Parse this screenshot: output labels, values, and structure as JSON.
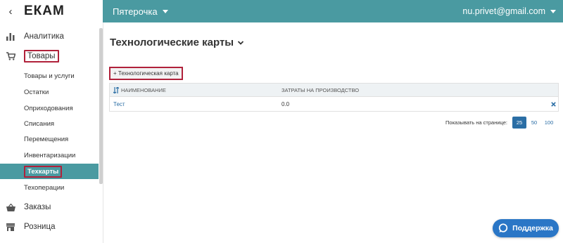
{
  "sidebar": {
    "back_glyph": "‹",
    "logo": "ЕКАМ",
    "items": [
      {
        "label": "Аналитика",
        "icon": "bar-chart-icon"
      },
      {
        "label": "Товары",
        "icon": "cart-icon"
      },
      {
        "label": "Заказы",
        "icon": "basket-icon"
      },
      {
        "label": "Розница",
        "icon": "store-icon"
      }
    ],
    "sub_items": [
      {
        "label": "Товары и услуги"
      },
      {
        "label": "Остатки"
      },
      {
        "label": "Оприходования"
      },
      {
        "label": "Списания"
      },
      {
        "label": "Перемещения"
      },
      {
        "label": "Инвентаризации"
      },
      {
        "label": "Техкарты"
      },
      {
        "label": "Техоперации"
      }
    ]
  },
  "header": {
    "store_name": "Пятерочка",
    "user_email": "nu.privet@gmail.com"
  },
  "main": {
    "title": "Технологические карты",
    "add_button": "+ Технологическая карта",
    "table": {
      "col_name": "НАИМЕНОВАНИЕ",
      "col_cost": "ЗАТРАТЫ НА ПРОИЗВОДСТВО",
      "rows": [
        {
          "name": "Тест",
          "cost": "0.0"
        }
      ]
    },
    "pager": {
      "label": "Показывать на странице:",
      "options": [
        "25",
        "50",
        "100"
      ],
      "selected": "25"
    }
  },
  "support_button": "Поддержка",
  "colors": {
    "teal": "#4a9aa1",
    "highlight_red": "#b0213a",
    "link_blue": "#2b6ea5",
    "support_blue": "#2a76c6"
  }
}
